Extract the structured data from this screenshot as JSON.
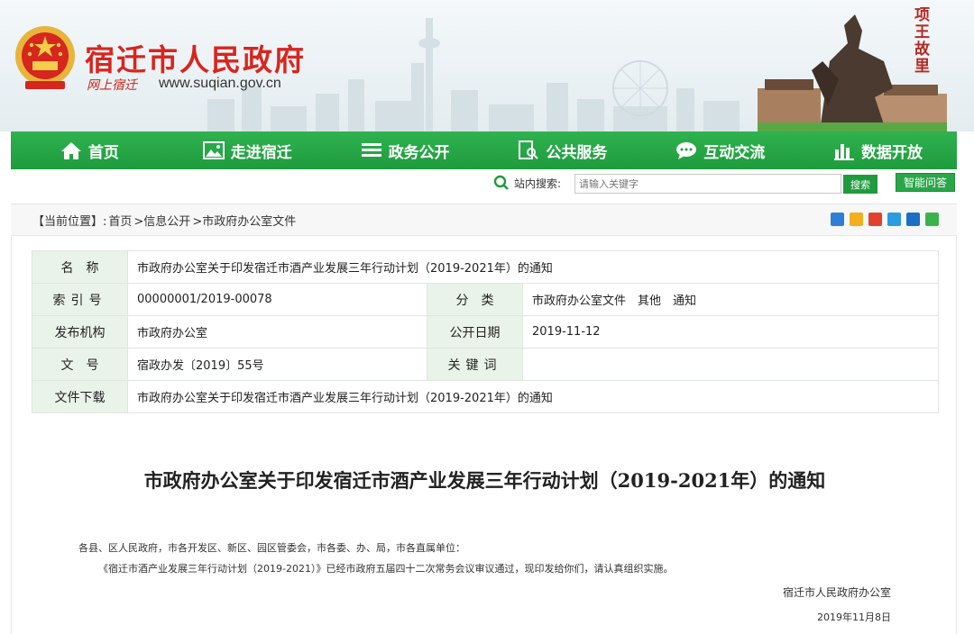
{
  "header": {
    "site_name": "宿迁市人民政府",
    "site_slogan": "网上宿迁",
    "site_url": "www.suqian.gov.cn",
    "seal_text": "项王故里"
  },
  "nav": {
    "items": [
      {
        "label": "首页",
        "icon": "home-icon"
      },
      {
        "label": "走进宿迁",
        "icon": "picture-icon"
      },
      {
        "label": "政务公开",
        "icon": "list-icon"
      },
      {
        "label": "公共服务",
        "icon": "document-search-icon"
      },
      {
        "label": "互动交流",
        "icon": "chat-icon"
      },
      {
        "label": "数据开放",
        "icon": "data-chart-icon"
      }
    ]
  },
  "search": {
    "label": "站内搜索:",
    "placeholder": "请输入关键字",
    "button": "搜索",
    "qa_button": "智能问答"
  },
  "breadcrumb": {
    "prefix": "【当前位置】:",
    "items": [
      "首页",
      ">信息公开",
      ">市政府办公室文件"
    ]
  },
  "meta": {
    "name_label": "名　称",
    "name_value": "市政府办公室关于印发宿迁市酒产业发展三年行动计划（2019-2021年）的通知",
    "index_label": "索引号",
    "index_value": "00000001/2019-00078",
    "category_label": "分　类",
    "category_value": "市政府办公室文件　其他　通知",
    "publisher_label": "发布机构",
    "publisher_value": "市政府办公室",
    "date_label": "公开日期",
    "date_value": "2019-11-12",
    "doc_label": "文　号",
    "doc_value": "宿政办发〔2019〕55号",
    "keyword_label": "关键词",
    "keyword_value": "",
    "download_label": "文件下载",
    "download_value": "市政府办公室关于印发宿迁市酒产业发展三年行动计划（2019-2021年）的通知"
  },
  "article": {
    "title": "市政府办公室关于印发宿迁市酒产业发展三年行动计划（2019-2021年）的通知",
    "recipients": "各县、区人民政府，市各开发区、新区、园区管委会，市各委、办、局，市各直属单位：",
    "body": "《宿迁市酒产业发展三年行动计划（2019-2021）》已经市政府五届四十二次常务会议审议通过，现印发给你们，请认真组织实施。",
    "signature": "宿迁市人民政府办公室",
    "date": "2019年11月8日"
  },
  "colors": {
    "nav_green": "#1f9b3e",
    "brand_red": "#d7261e",
    "label_bg": "#eaf3ea"
  }
}
